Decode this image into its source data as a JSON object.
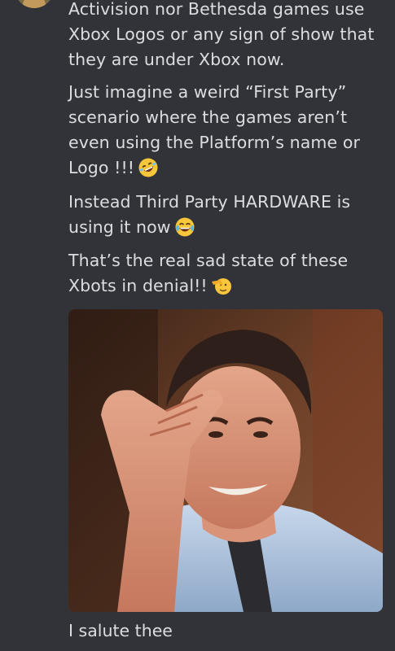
{
  "message": {
    "line1": "Activision nor Bethesda games use Xbox Logos or any sign of show that they are under Xbox now.",
    "line2": "Just imagine a weird “First Party” scenario where the games aren’t even using the Platform’s name or Logo !!!",
    "line2_emoji": "rolling-on-floor-laughing-emoji",
    "line3": "Instead Third Party HARDWARE is using it now",
    "line3_emoji": "tears-of-joy-emoji",
    "line4": "That’s the real sad state of these Xbots in denial!!",
    "line4_emoji": "saluting-face-emoji"
  },
  "attachment": {
    "type": "image",
    "subject": "man saluting"
  },
  "follow_up": {
    "text": "I salute thee"
  },
  "colors": {
    "background": "#313338",
    "text": "#dbdee1"
  }
}
